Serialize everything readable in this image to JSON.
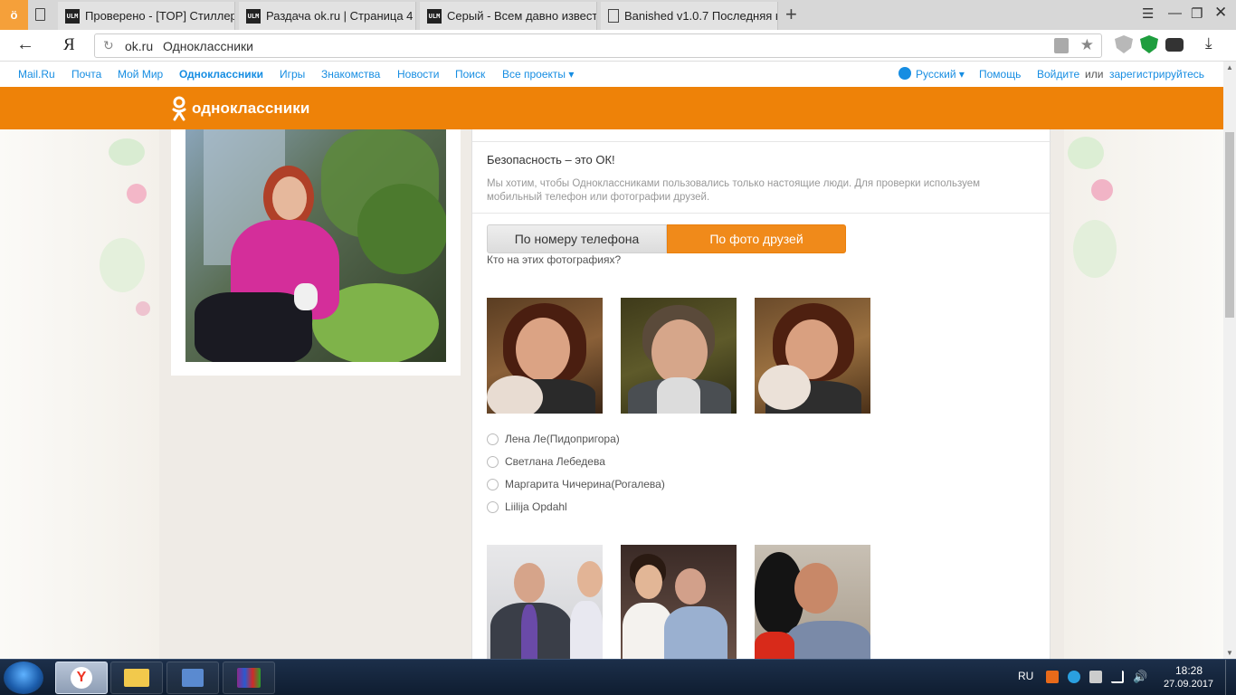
{
  "browser": {
    "tabs": [
      {
        "title": "Проверено - [TOP] Стиллер"
      },
      {
        "title": "Раздача ok.ru | Страница 4"
      },
      {
        "title": "Серый - Всем давно извест"
      },
      {
        "title": "Banished v1.0.7 Последняя в"
      }
    ],
    "favicon_text": "ULM",
    "yandex_button": "ö",
    "new_tab": "+",
    "address": {
      "domain": "ok.ru",
      "title": "Одноклассники"
    },
    "yandex_logo": "Я"
  },
  "portal_nav": {
    "items": [
      "Mail.Ru",
      "Почта",
      "Мой Мир",
      "Одноклассники",
      "Игры",
      "Знакомства",
      "Новости",
      "Поиск",
      "Все проекты ▾"
    ],
    "language": "Русский ▾",
    "help": "Помощь",
    "login": "Войдите",
    "or": "или",
    "register": "зарегистрируйтесь"
  },
  "ok_header": {
    "logo_text": "одноклассники"
  },
  "security": {
    "title": "Безопасность – это ОК!",
    "description": "Мы хотим, чтобы Одноклассниками пользовались только настоящие люди. Для проверки используем мобильный телефон или фотографии друзей.",
    "tab_phone": "По номеру телефона",
    "tab_photo": "По фото друзей",
    "question": "Кто на этих фотографиях?",
    "options": [
      "Лена Ле(Пидопригора)",
      "Светлана Лебедева",
      "Маргарита Чичерина(Рогалева)",
      "Liilija Opdahl"
    ]
  },
  "taskbar": {
    "lang": "RU",
    "time": "18:28",
    "date": "27.09.2017"
  },
  "colors": {
    "ok_orange": "#ee8208",
    "link_blue": "#168de2"
  }
}
